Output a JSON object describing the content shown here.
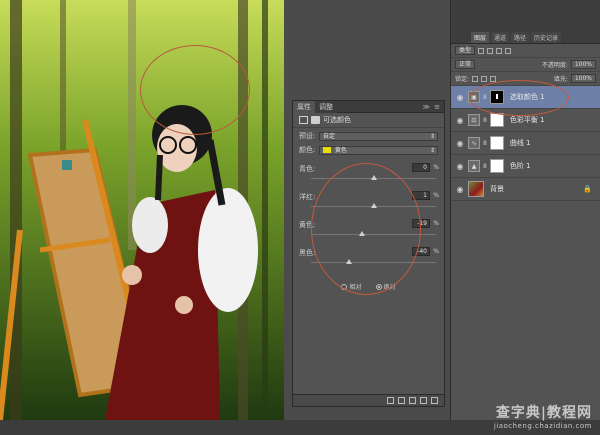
{
  "properties_panel": {
    "tabs": [
      "属性",
      "调整"
    ],
    "title": "可选颜色",
    "preset": {
      "label": "预设:",
      "value": "自定"
    },
    "colors": {
      "label": "颜色:",
      "value": "黄色"
    },
    "sliders": [
      {
        "label": "青色:",
        "value": "0",
        "percent": 0
      },
      {
        "label": "洋红:",
        "value": "1",
        "percent": 1
      },
      {
        "label": "黄色:",
        "value": "-19",
        "percent": -19
      },
      {
        "label": "黑色:",
        "value": "-40",
        "percent": -40
      }
    ],
    "percent_sign": "%",
    "method": {
      "relative": "相对",
      "absolute": "绝对",
      "selected": "absolute"
    }
  },
  "layers_panel": {
    "tabs": [
      "图层",
      "通道",
      "路径",
      "历史记录"
    ],
    "kind_filter": "类型",
    "blend_mode": "正常",
    "opacity_label": "不透明度:",
    "opacity": "100%",
    "lock_label": "锁定:",
    "fill_label": "填充:",
    "fill": "100%",
    "layers": [
      {
        "name": "选取颜色 1",
        "mask": "black",
        "selected": true
      },
      {
        "name": "色彩平衡 1",
        "mask": "white",
        "selected": false
      },
      {
        "name": "曲线 1",
        "mask": "white",
        "selected": false
      },
      {
        "name": "色阶 1",
        "mask": "white",
        "selected": false
      },
      {
        "name": "背景",
        "mask": "none",
        "selected": false,
        "locked": true
      }
    ]
  },
  "watermark": {
    "title": "查字典|教程网",
    "url": "jiaocheng.chazidian.com"
  },
  "colors": {
    "accent_selected": "#6e7fa8",
    "annotation": "#c45a3a",
    "swatch_yellow": "#e8e000"
  }
}
